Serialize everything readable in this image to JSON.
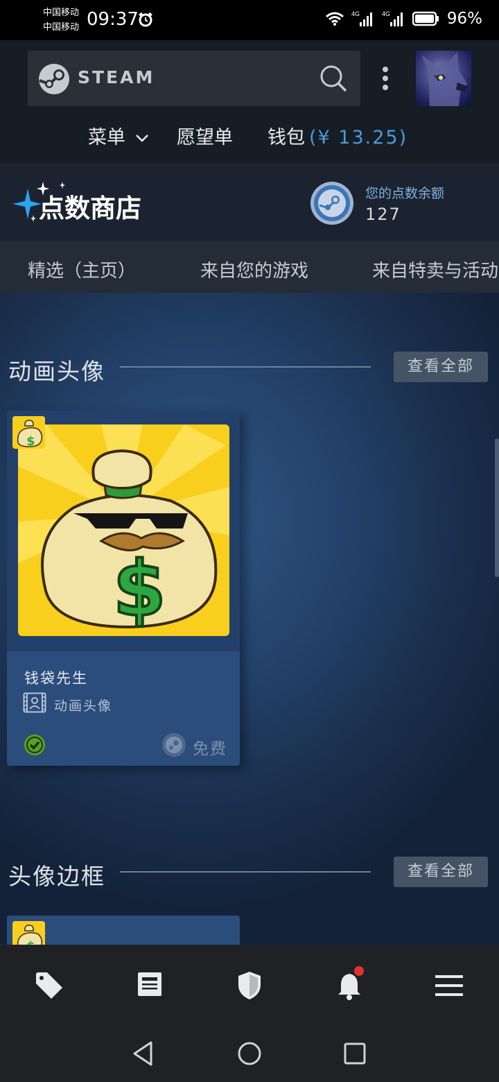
{
  "status_bar": {
    "carrier_1": "中国移动",
    "carrier_2": "中国移动",
    "time": "09:37",
    "network_1": "4G",
    "network_2": "4G",
    "battery": "96%"
  },
  "header": {
    "brand": "STEAM",
    "nav": {
      "menu_label": "菜单",
      "wishlist_label": "愿望单",
      "wallet_label": "钱包",
      "wallet_amount": "(¥ 13.25)"
    }
  },
  "points_shop": {
    "title": "点数商店",
    "balance_label": "您的点数余额",
    "balance_value": "127"
  },
  "tabs": [
    {
      "label": "精选（主页）"
    },
    {
      "label": "来自您的游戏"
    },
    {
      "label": "来自特卖与活动"
    }
  ],
  "sections": [
    {
      "title": "动画头像",
      "view_all": "查看全部",
      "items": [
        {
          "name": "钱袋先生",
          "type": "动画头像",
          "price": "免费"
        }
      ]
    },
    {
      "title": "头像边框",
      "view_all": "查看全部"
    }
  ],
  "icons": {
    "bottom_nav": [
      "tag-icon",
      "news-icon",
      "shield-icon",
      "bell-icon",
      "hamburger-menu-icon"
    ],
    "android_nav": [
      "back-icon",
      "home-icon",
      "recents-icon"
    ]
  },
  "colors": {
    "accent_blue": "#4c9bd8",
    "owned_green": "#59a11e",
    "notification_red": "#e0332f"
  }
}
